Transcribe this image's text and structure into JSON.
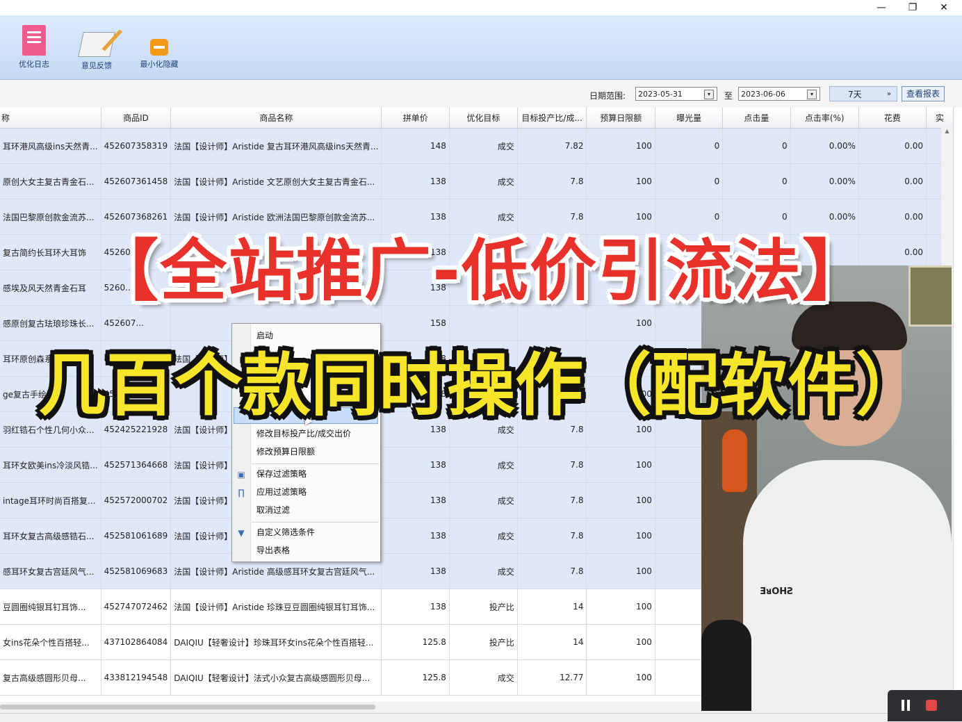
{
  "window": {
    "minimize": "—",
    "restore": "❐",
    "close": "✕"
  },
  "toolbar": {
    "log_label": "优化日志",
    "feedback_label": "意见反馈",
    "minimize_label": "最小化隐藏"
  },
  "filter": {
    "date_range_label": "日期范围:",
    "start_date": "2023-05-31",
    "to_label": "至",
    "end_date": "2023-06-06",
    "period_value": "7天",
    "view_report_label": "查看报表"
  },
  "table": {
    "headers": [
      "称",
      "商品ID",
      "商品名称",
      "拼单价",
      "优化目标",
      "目标投产比/成...",
      "预算日限额",
      "曝光量",
      "点击量",
      "点击率(%)",
      "花费",
      "实"
    ],
    "rows": [
      [
        "耳环港风高级ins天然青...",
        "452607358319",
        "法国【设计师】Aristide 复古耳环港风高级ins天然青...",
        "148",
        "成交",
        "7.82",
        "100",
        "0",
        "0",
        "0.00%",
        "0.00"
      ],
      [
        "原创大女主复古青金石...",
        "452607361458",
        "法国【设计师】Aristide 文艺原创大女主复古青金石...",
        "138",
        "成交",
        "7.8",
        "100",
        "0",
        "0",
        "0.00%",
        "0.00"
      ],
      [
        "法国巴黎原创款金流苏...",
        "452607368261",
        "法国【设计师】Aristide 欧洲法国巴黎原创款金流苏...",
        "138",
        "成交",
        "7.8",
        "100",
        "0",
        "0",
        "0.00%",
        "0.00"
      ],
      [
        "复古简约长耳环大耳饰",
        "4526073...",
        "",
        "138",
        "",
        "7",
        "1",
        "",
        "",
        "",
        "0.00"
      ],
      [
        "感埃及风天然青金石耳",
        "5260...",
        "",
        "138",
        "",
        "",
        "1",
        "",
        "",
        "",
        ""
      ],
      [
        "感原创复古珐琅珍珠长...",
        "452607...",
        "",
        "158",
        "",
        "",
        "100",
        "",
        "",
        "",
        ""
      ],
      [
        "耳环原创森系文",
        "452...",
        "法国【设计师】A",
        "138",
        "",
        "",
        "100",
        "",
        "",
        "",
        ""
      ],
      [
        "ge复古手绘珐",
        "452...",
        "",
        "138",
        "",
        "",
        "100",
        "",
        "",
        "",
        ""
      ],
      [
        "羽红锆石个性几何小众...",
        "452425221928",
        "法国【设计师】A",
        "138",
        "成交",
        "7.8",
        "100",
        "",
        "",
        "",
        ""
      ],
      [
        "耳环女欧美ins冷淡风锆...",
        "452571364668",
        "法国【设计师】A",
        "138",
        "成交",
        "7.8",
        "100",
        "",
        "",
        "",
        ""
      ],
      [
        "intage耳环时尚百搭复...",
        "452572000702",
        "法国【设计师】A",
        "138",
        "成交",
        "7.8",
        "100",
        "",
        "",
        "",
        ""
      ],
      [
        "耳环女复古高级感锆石...",
        "452581061689",
        "法国【设计师】A",
        "138",
        "成交",
        "7.8",
        "100",
        "",
        "",
        "",
        ""
      ],
      [
        "感耳环女复古宫廷风气...",
        "452581069683",
        "法国【设计师】Aristide 高级感耳环女复古宫廷风气...",
        "138",
        "成交",
        "7.8",
        "100",
        "",
        "",
        "",
        ""
      ],
      [
        "豆圆圈纯银耳钉耳饰...",
        "452747072462",
        "法国【设计师】Aristide 珍珠豆豆圆圈纯银耳钉耳饰...",
        "138",
        "投产比",
        "14",
        "100",
        "",
        "",
        "",
        ""
      ],
      [
        "女ins花朵个性百搭轻...",
        "437102864084",
        "DAIQIU【轻奢设计】珍珠耳环女ins花朵个性百搭轻...",
        "125.8",
        "投产比",
        "14",
        "100",
        "",
        "",
        "",
        ""
      ],
      [
        "复古高级感圆形贝母...",
        "433812194548",
        "DAIQIU【轻奢设计】法式小众复古高级感圆形贝母...",
        "125.8",
        "成交",
        "12.77",
        "100",
        "",
        "",
        "",
        ""
      ]
    ]
  },
  "context_menu": {
    "items": [
      "启动",
      "暂",
      "",
      "修改目标投产比/成交出价",
      "修改预算日限额",
      "保存过滤策略",
      "应用过滤策略",
      "取消过滤",
      "自定义筛选条件",
      "导出表格"
    ]
  },
  "overlay": {
    "title_line1": "【全站推广-低价引流法】",
    "title_line2": "几百个款同时操作（配软件）"
  },
  "video": {
    "shirt_logo": "ƎᴚOHƧ"
  }
}
